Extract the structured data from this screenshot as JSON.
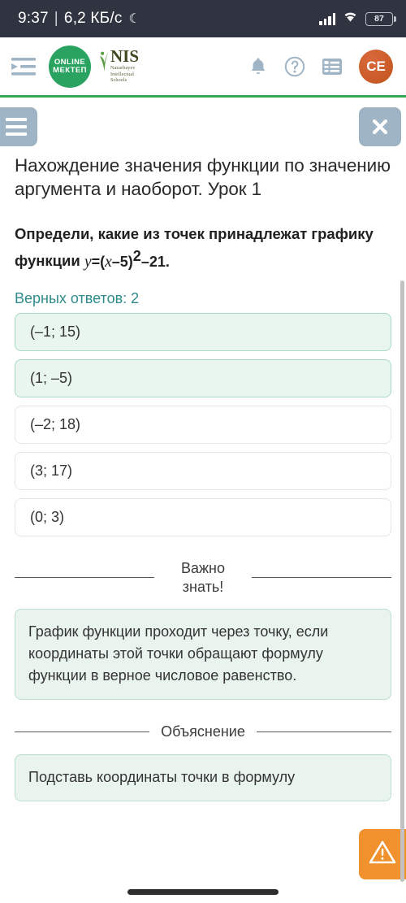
{
  "status_bar": {
    "time": "9:37",
    "separator": "|",
    "data_rate": "6,2 КБ/с",
    "moon_icon": "crescent-moon-icon",
    "battery_level": "87",
    "bg_color": "#2f3440"
  },
  "app_header": {
    "menu_toggle_icon": "indent-menu-icon",
    "logo_mektep_line1": "ONLINE",
    "logo_mektep_line2": "МЕКТЕП",
    "logo_nis_title": "NIS",
    "logo_nis_sub_line1": "Nazarbayev",
    "logo_nis_sub_line2": "Intellectual",
    "logo_nis_sub_line3": "Schools",
    "bell_icon": "bell-icon",
    "help_icon": "question-circle-icon",
    "list_icon": "list-icon",
    "avatar_initials": "СЕ",
    "accent_color": "#34a853",
    "avatar_color": "#c2551f"
  },
  "toolbar": {
    "menu_icon": "hamburger-icon",
    "close_icon": "close-x-icon",
    "button_color": "#9fb4c4"
  },
  "lesson": {
    "title": "Нахождение значения функции по значению аргумента и наоборот. Урок 1"
  },
  "question": {
    "text_before": "Определи, какие из точек принадлежат графику функции",
    "formula": {
      "y": "y",
      "eq": "=",
      "open": "(",
      "x": "x",
      "minus1": "–",
      "five": "5",
      "close": ")",
      "power": "2",
      "minus2": "–",
      "twentyone": "21",
      "period": "."
    },
    "correct_count_label": "Верных ответов: 2",
    "correct_count_color": "#2f8b8b"
  },
  "options": [
    {
      "label": "(–1; 15)",
      "selected": true
    },
    {
      "label": "(1; –5)",
      "selected": true
    },
    {
      "label": "(–2; 18)",
      "selected": false
    },
    {
      "label": "(3; 17)",
      "selected": false
    },
    {
      "label": "(0; 3)",
      "selected": false
    }
  ],
  "important_section": {
    "divider_label": "Важно знать!",
    "text": "График функции проходит через точку, если координаты этой точки обращают формулу функции в верное числовое равенство."
  },
  "explanation_section": {
    "divider_label": "Объяснение",
    "text": "Подставь координаты точки в формулу"
  },
  "fab": {
    "icon": "warning-triangle-icon",
    "color": "#f0912e"
  }
}
